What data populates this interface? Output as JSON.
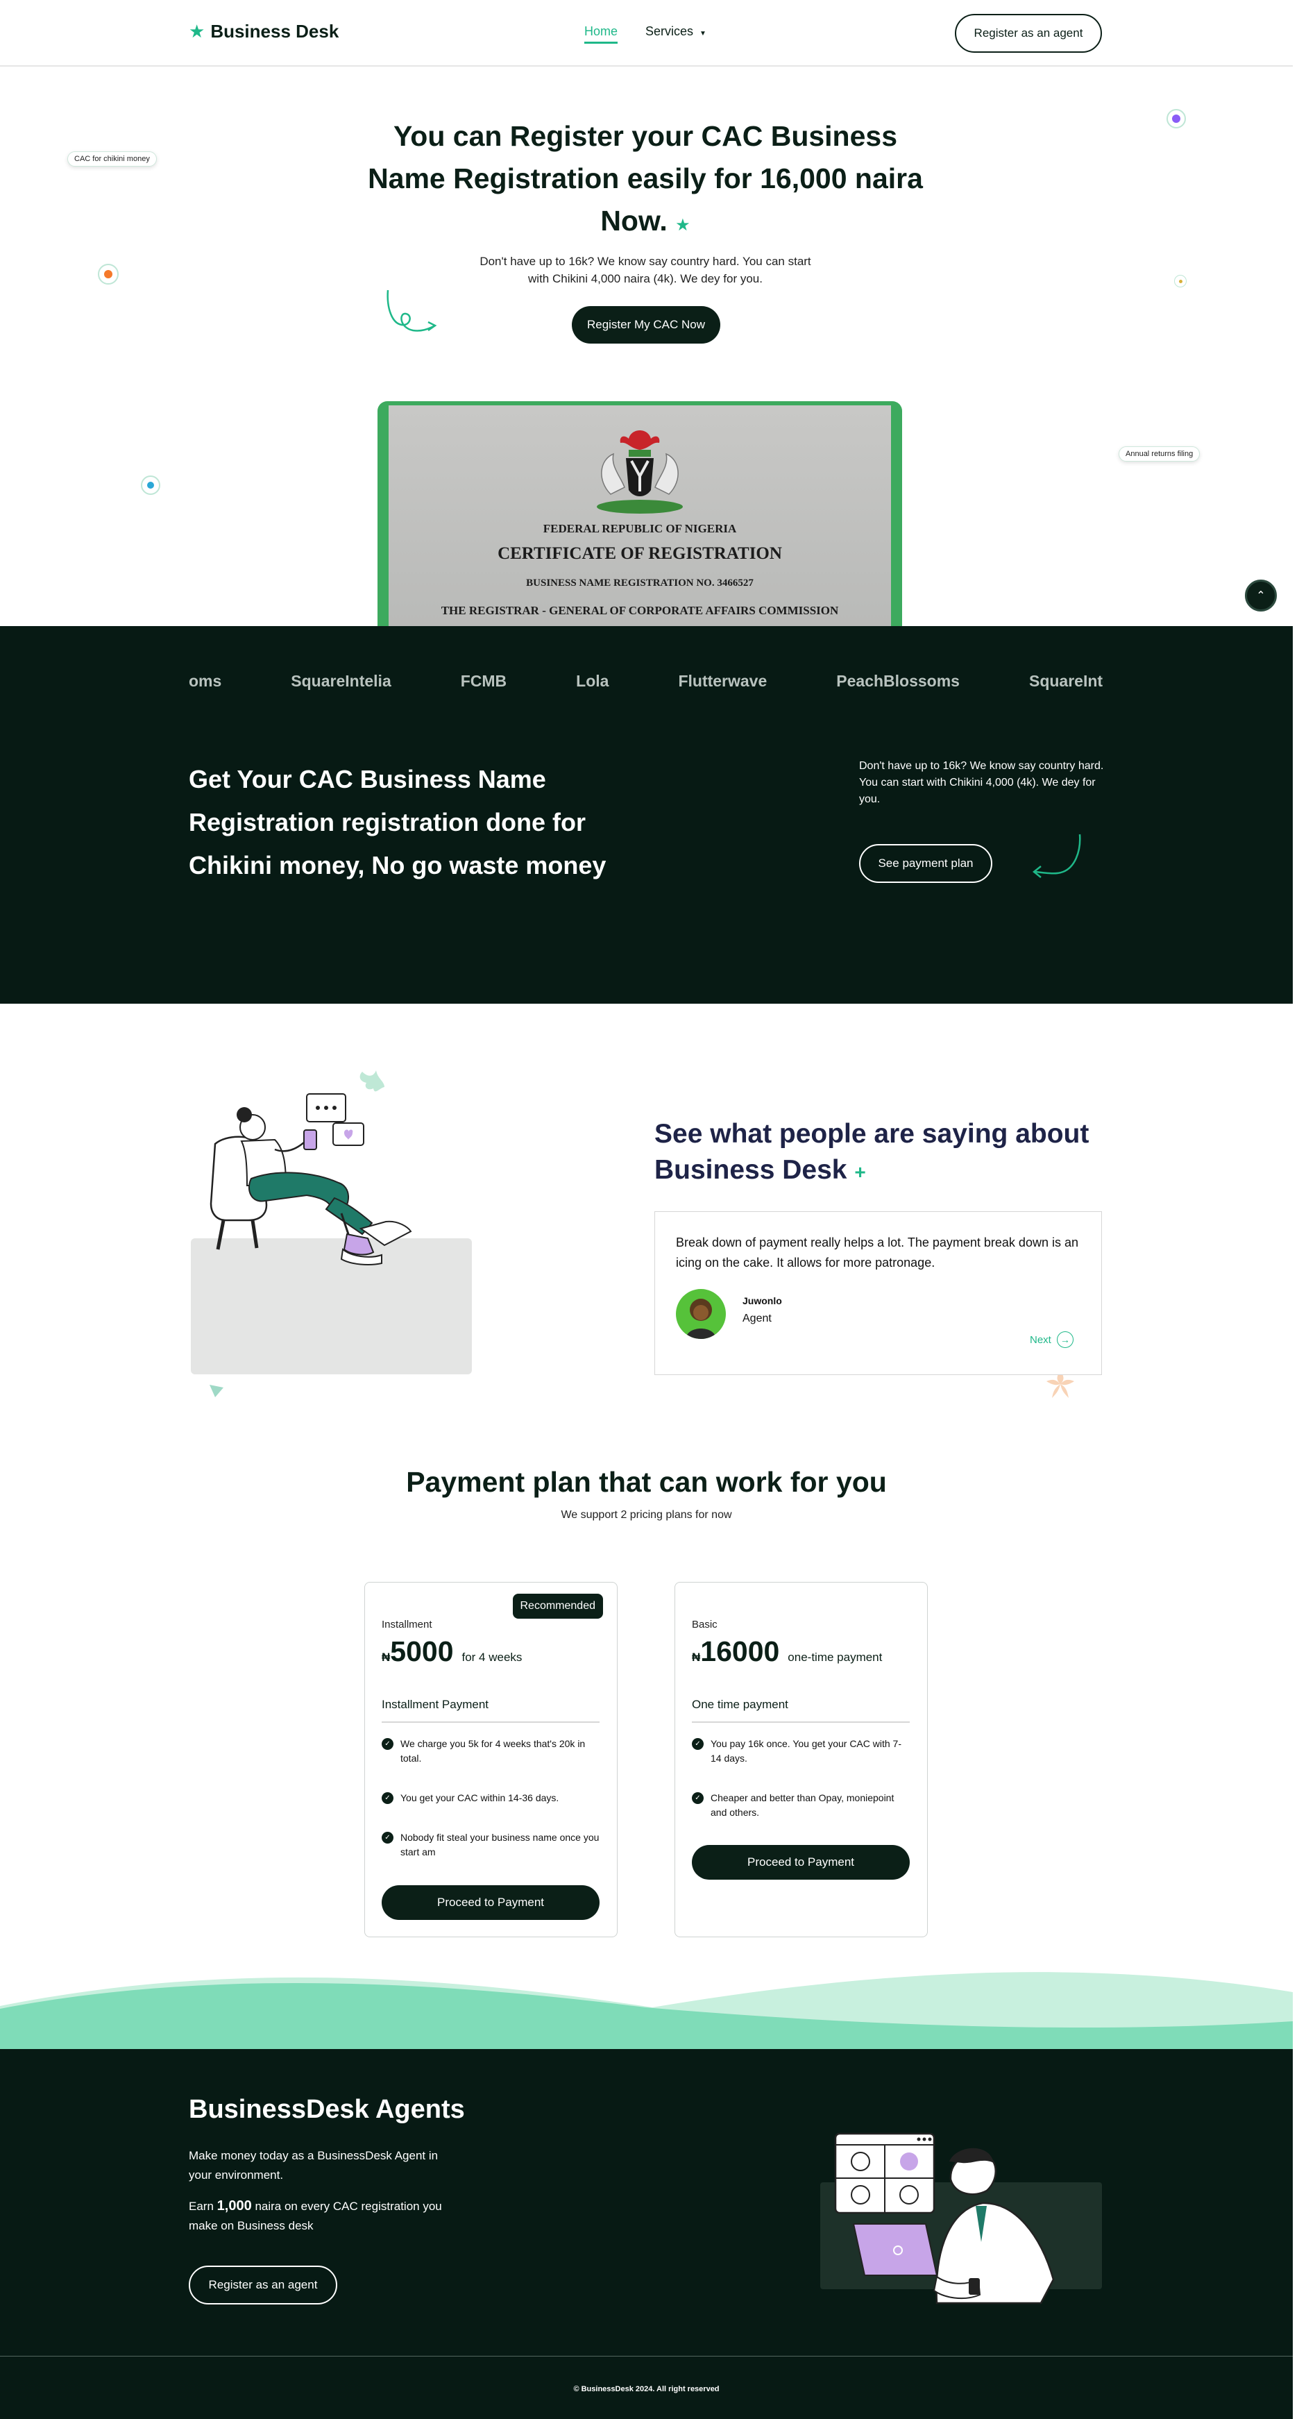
{
  "nav": {
    "logo_text": "Business Desk",
    "links": [
      {
        "label": "Home"
      },
      {
        "label": "Services"
      }
    ],
    "cta_label": "Register as an agent"
  },
  "hero": {
    "title": "You can Register your CAC Business Name Registration easily for 16,000 naira Now.",
    "subtitle": "Don't have up to 16k? We know say country hard. You can start with Chikini 4,000 naira (4k). We dey for you.",
    "cta_label": "Register My CAC Now",
    "chips": [
      "CAC for chikini money",
      "Annual returns filing"
    ],
    "certificate": {
      "line1": "FEDERAL REPUBLIC OF NIGERIA",
      "line2": "CERTIFICATE OF REGISTRATION",
      "line3": "BUSINESS NAME REGISTRATION NO. 3466527",
      "line4": "THE REGISTRAR - GENERAL OF CORPORATE AFFAIRS COMMISSION"
    }
  },
  "partners": [
    "oms",
    "SquareIntelia",
    "FCMB",
    "Lola",
    "Flutterwave",
    "PeachBlossoms",
    "SquareIntel"
  ],
  "band": {
    "title": "Get Your CAC Business Name Registration registration done for Chikini money, No go waste money",
    "subtitle": "Don't have up to 16k? We know say country hard. You can start with Chikini 4,000 (4k). We dey for you.",
    "cta_label": "See payment plan"
  },
  "testimonials": {
    "title": "See what people are saying about Business Desk",
    "quote": "Break down of payment really helps a lot. The payment break down is an icing on the cake. It allows for more patronage.",
    "name": "Juwonlo",
    "role": "Agent",
    "next_label": "Next"
  },
  "pricing": {
    "title": "Payment plan that can work for you",
    "subtitle": "We support 2 pricing plans for now",
    "plans": [
      {
        "badge": "Recommended",
        "name": "Installment",
        "currency": "₦",
        "amount": "5000",
        "suffix": "for 4 weeks",
        "type": "Installment Payment",
        "features": [
          "We charge you 5k for 4 weeks that's 20k in total.",
          "You get your CAC within 14-36 days.",
          "Nobody fit steal your business name once you start am"
        ],
        "cta_label": "Proceed to Payment"
      },
      {
        "name": "Basic",
        "currency": "₦",
        "amount": "16000",
        "suffix": "one-time payment",
        "type": "One time payment",
        "features": [
          "You pay 16k once. You get your CAC with 7-14 days.",
          "Cheaper and better than Opay, moniepoint and others."
        ],
        "cta_label": "Proceed to Payment"
      }
    ]
  },
  "footer": {
    "title": "BusinessDesk Agents",
    "p1": "Make money today as a BusinessDesk Agent in your environment.",
    "p2_pre": "Earn",
    "p2_amount": "1,000",
    "p2_post": "naira on every CAC registration you make on Business desk",
    "cta_label": "Register as an agent",
    "copyright": "© BusinessDesk 2024. All right reserved"
  },
  "colors": {
    "accent": "#1fb889",
    "dark": "#071a14",
    "heading_navy": "#1e2347",
    "wave_light": "#c8f0de",
    "wave_mid": "#7fdcb8"
  },
  "icons": [
    "star-icon",
    "chevron-down-icon",
    "chevrons-up-icon",
    "plus-icon",
    "check-icon"
  ]
}
